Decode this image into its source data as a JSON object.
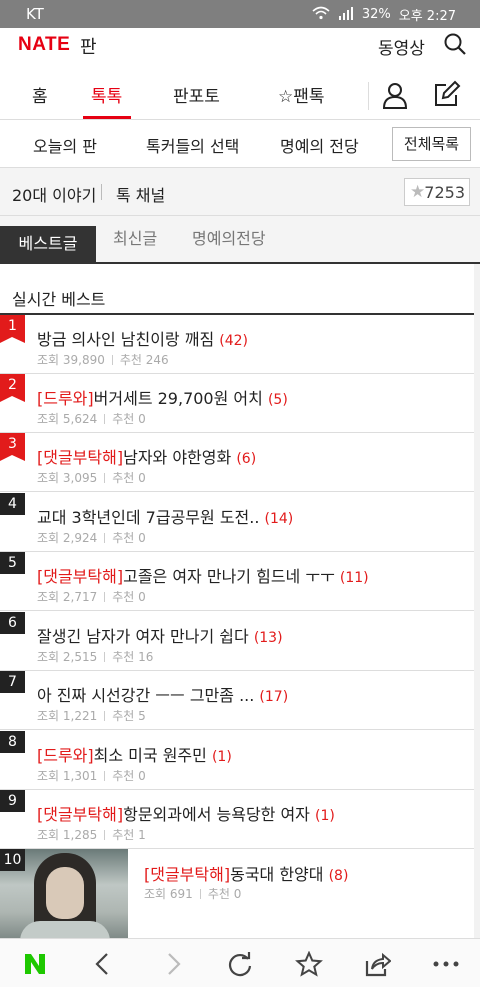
{
  "status_bar": {
    "carrier": "KT",
    "battery": "32%",
    "time": "오후 2:27"
  },
  "header": {
    "logo": "NATE",
    "service": "판",
    "video": "동영상"
  },
  "main_nav": {
    "tabs": [
      "홈",
      "톡톡",
      "판포토",
      "☆팬톡"
    ],
    "active": "톡톡"
  },
  "sub_nav": {
    "items": [
      "오늘의 판",
      "톡커들의 선택",
      "명예의 전당"
    ],
    "all_button": "전체목록"
  },
  "channel": {
    "name": "20대 이야기",
    "type": "톡 채널",
    "star_count": "7253"
  },
  "list_tabs": [
    "베스트글",
    "최신글",
    "명예의전당"
  ],
  "section_title": "실시간 베스트",
  "posts": [
    {
      "rank": "1",
      "tag": "",
      "title": "방금 의사인 남친이랑 깨짐",
      "comments": "(42)",
      "views_label": "조회 39,890",
      "likes_label": "추천 246"
    },
    {
      "rank": "2",
      "tag": "[드루와]",
      "title": "버거세트 29,700원 어치",
      "comments": "(5)",
      "views_label": "조회 5,624",
      "likes_label": "추천 0"
    },
    {
      "rank": "3",
      "tag": "[댓글부탁해]",
      "title": "남자와 야한영화",
      "comments": "(6)",
      "views_label": "조회 3,095",
      "likes_label": "추천 0"
    },
    {
      "rank": "4",
      "tag": "",
      "title": "교대 3학년인데 7급공무원 도전..",
      "comments": "(14)",
      "views_label": "조회 2,924",
      "likes_label": "추천 0"
    },
    {
      "rank": "5",
      "tag": "[댓글부탁해]",
      "title": "고졸은 여자 만나기 힘드네 ㅜㅜ",
      "comments": "(11)",
      "views_label": "조회 2,717",
      "likes_label": "추천 0"
    },
    {
      "rank": "6",
      "tag": "",
      "title": "잘생긴 남자가 여자 만나기 쉽다",
      "comments": "(13)",
      "views_label": "조회 2,515",
      "likes_label": "추천 16"
    },
    {
      "rank": "7",
      "tag": "",
      "title": "아 진짜 시선강간 ㅡㅡ 그만좀 ...",
      "comments": "(17)",
      "views_label": "조회 1,221",
      "likes_label": "추천 5"
    },
    {
      "rank": "8",
      "tag": "[드루와]",
      "title": "최소 미국 원주민",
      "comments": "(1)",
      "views_label": "조회 1,301",
      "likes_label": "추천 0"
    },
    {
      "rank": "9",
      "tag": "[댓글부탁해]",
      "title": "항문외과에서 능욕당한 여자",
      "comments": "(1)",
      "views_label": "조회 1,285",
      "likes_label": "추천 1"
    },
    {
      "rank": "10",
      "tag": "[댓글부탁해]",
      "title": "동국대 한양대",
      "comments": "(8)",
      "views_label": "조회 691",
      "likes_label": "추천 0"
    }
  ],
  "browser_bar": [
    "naver-home-icon",
    "back-icon",
    "forward-icon",
    "refresh-icon",
    "bookmark-star-icon",
    "share-icon",
    "more-icon"
  ]
}
